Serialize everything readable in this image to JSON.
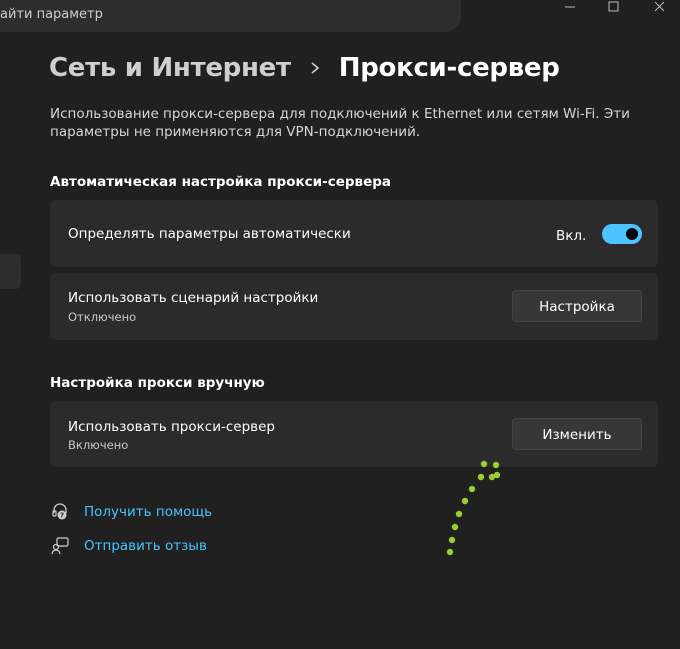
{
  "search": {
    "text": "айти параметр"
  },
  "window_controls": {
    "minimize_icon": "minimize-icon",
    "maximize_icon": "maximize-icon",
    "close_icon": "close-icon"
  },
  "breadcrumb": {
    "parent": "Сеть и Интернет",
    "separator_icon": "chevron-right-icon",
    "current": "Прокси-сервер"
  },
  "description": "Использование прокси-сервера для подключений к Ethernet или сетям Wi-Fi. Эти параметры не применяются для VPN-подключений.",
  "auto_section": {
    "heading": "Автоматическая настройка прокси-сервера",
    "detect": {
      "label": "Определять параметры автоматически",
      "toggle_state_label": "Вкл.",
      "toggle_on": true
    },
    "script": {
      "label": "Использовать сценарий настройки",
      "status": "Отключено",
      "button": "Настройка"
    }
  },
  "manual_section": {
    "heading": "Настройка прокси вручную",
    "proxy": {
      "label": "Использовать прокси-сервер",
      "status": "Включено",
      "button": "Изменить"
    }
  },
  "links": [
    {
      "label": "Получить помощь",
      "icon": "help-icon"
    },
    {
      "label": "Отправить отзыв",
      "icon": "feedback-icon"
    }
  ],
  "colors": {
    "background": "#202020",
    "card": "#2b2b2b",
    "accent": "#4cc2ff",
    "annotation_arrow": "#9acd32"
  }
}
